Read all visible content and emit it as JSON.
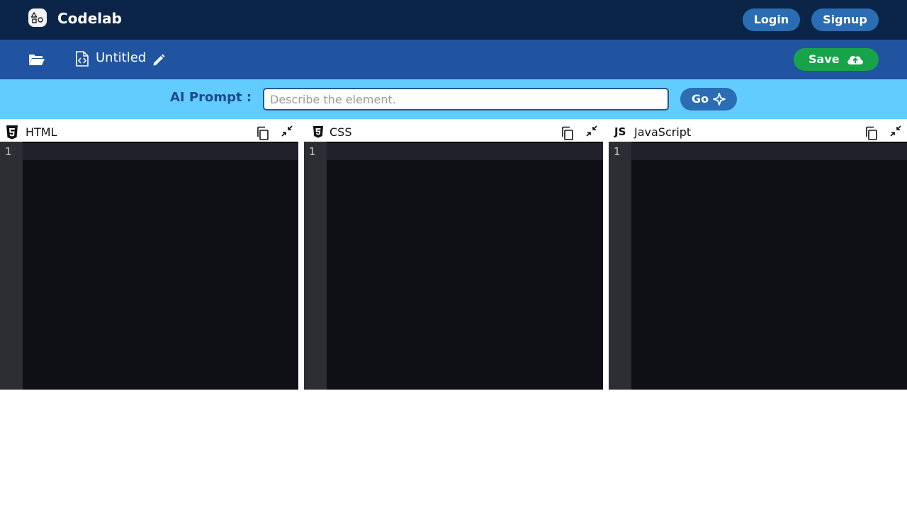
{
  "navbar": {
    "brand": "Codelab",
    "login_label": "Login",
    "signup_label": "Signup",
    "background": "#0b2548",
    "button_color": "#2a6db2"
  },
  "toolbar": {
    "file_title": "Untitled",
    "save_label": "Save",
    "background": "#2154a0",
    "save_color": "#17a34a",
    "icons": [
      "folder-open-icon",
      "file-code-icon",
      "pencil-icon",
      "cloud-upload-icon"
    ]
  },
  "ai_prompt": {
    "label": "AI Prompt :",
    "placeholder": "Describe the element.",
    "value": "",
    "go_label": "Go",
    "background": "#63ccff"
  },
  "editors": [
    {
      "title": "HTML",
      "icon": "html5-icon",
      "lines": [
        "1"
      ]
    },
    {
      "title": "CSS",
      "icon": "css3-icon",
      "lines": [
        "1"
      ]
    },
    {
      "title": "JavaScript",
      "icon": "js-icon",
      "icon_text": "JS",
      "lines": [
        "1"
      ]
    }
  ]
}
